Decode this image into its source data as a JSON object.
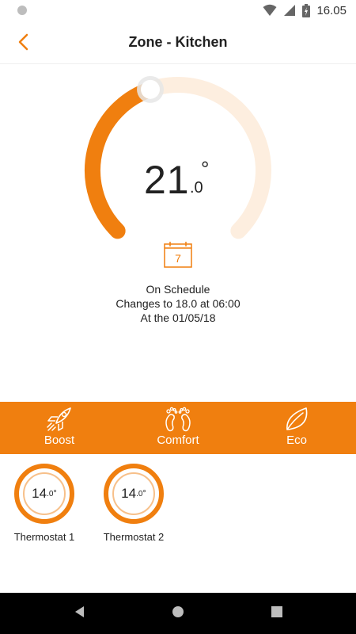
{
  "status": {
    "time": "16.05"
  },
  "header": {
    "title": "Zone - Kitchen"
  },
  "dial": {
    "temp_int": "21",
    "temp_dec": ".0",
    "degree": "°",
    "setpoint_fraction": 0.43,
    "calendar_day": "7"
  },
  "schedule": {
    "line1": "On Schedule",
    "line2": "Changes to 18.0 at 06:00",
    "line3": "At the 01/05/18"
  },
  "modes": [
    {
      "label": "Boost",
      "icon": "rocket-icon"
    },
    {
      "label": "Comfort",
      "icon": "feet-icon"
    },
    {
      "label": "Eco",
      "icon": "leaf-icon"
    }
  ],
  "thermostats": [
    {
      "name": "Thermostat 1",
      "int": "14",
      "dec": ".0",
      "deg": "°"
    },
    {
      "name": "Thermostat 2",
      "int": "14",
      "dec": ".0",
      "deg": "°"
    }
  ],
  "colors": {
    "accent": "#f07f0f",
    "track": "#fdeedf"
  }
}
